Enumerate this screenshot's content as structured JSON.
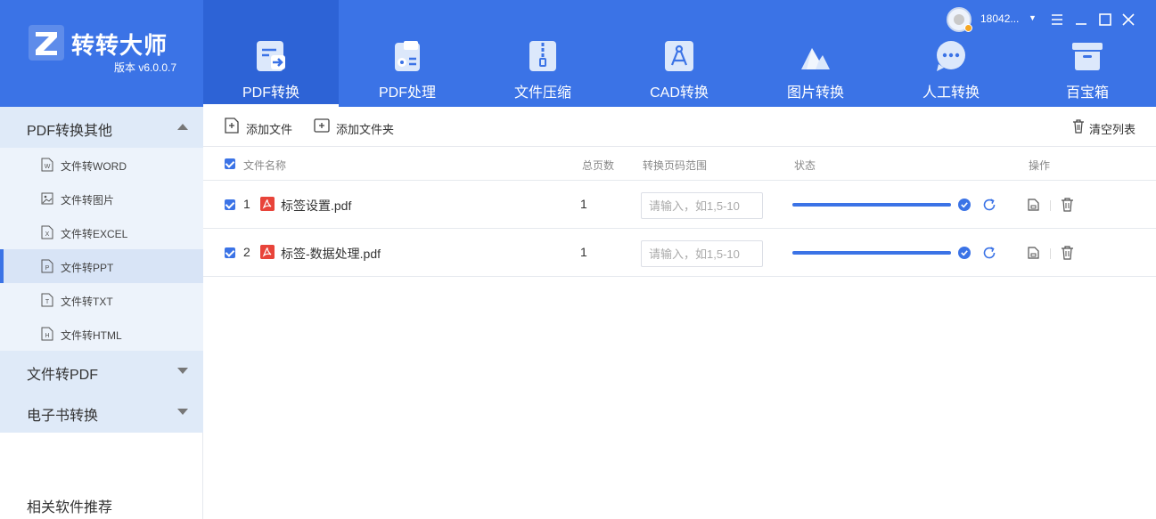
{
  "app": {
    "name": "转转大师",
    "version": "版本 v6.0.0.7"
  },
  "user": {
    "name": "18042..."
  },
  "nav_tabs": [
    {
      "label": "PDF转换",
      "icon": "pdf-convert-icon",
      "active": true
    },
    {
      "label": "PDF处理",
      "icon": "pdf-process-icon"
    },
    {
      "label": "文件压缩",
      "icon": "zip-icon"
    },
    {
      "label": "CAD转换",
      "icon": "cad-icon"
    },
    {
      "label": "图片转换",
      "icon": "image-icon"
    },
    {
      "label": "人工转换",
      "icon": "chat-icon"
    },
    {
      "label": "百宝箱",
      "icon": "box-icon"
    }
  ],
  "sidebar": {
    "groups": [
      {
        "label": "PDF转换其他",
        "expanded": true
      },
      {
        "label": "文件转PDF",
        "expanded": false
      },
      {
        "label": "电子书转换",
        "expanded": false
      }
    ],
    "items": [
      {
        "label": "文件转WORD",
        "icon_letter": "W"
      },
      {
        "label": "文件转图片",
        "icon_letter": "img"
      },
      {
        "label": "文件转EXCEL",
        "icon_letter": "X"
      },
      {
        "label": "文件转PPT",
        "icon_letter": "P",
        "active": true
      },
      {
        "label": "文件转TXT",
        "icon_letter": "T"
      },
      {
        "label": "文件转HTML",
        "icon_letter": "H"
      }
    ],
    "recommend": "相关软件推荐"
  },
  "toolbar": {
    "add_file": "添加文件",
    "add_folder": "添加文件夹",
    "clear_list": "清空列表"
  },
  "table": {
    "headers": {
      "name": "文件名称",
      "pages": "总页数",
      "range": "转换页码范围",
      "status": "状态",
      "actions": "操作"
    },
    "range_placeholder": "请输入，如1,5-10",
    "rows": [
      {
        "index": "1",
        "name": "标签设置.pdf",
        "pages": "1",
        "progress": 1.0,
        "checked": true
      },
      {
        "index": "2",
        "name": "标签-数据处理.pdf",
        "pages": "1",
        "progress": 1.0,
        "checked": true
      }
    ]
  },
  "colors": {
    "brand": "#3b73e6",
    "sidebar_bg": "#edf3fb",
    "pdf_red": "#e8443a"
  }
}
